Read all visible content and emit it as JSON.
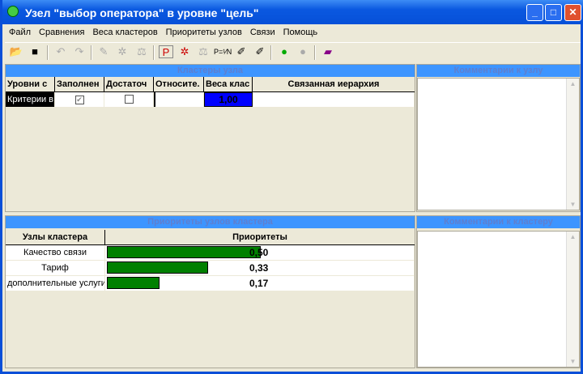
{
  "window": {
    "title": "Узел \"выбор оператора\" в уровне \"цель\"",
    "minimize": "_",
    "maximize": "□",
    "close": "✕"
  },
  "menu": [
    "Файл",
    "Сравнения",
    "Веса кластеров",
    "Приоритеты узлов",
    "Связи",
    "Помощь"
  ],
  "toolbar": {
    "icons": [
      "open-icon",
      "save-icon",
      "undo-icon",
      "redo-icon",
      "edit-icon",
      "wand-w-icon",
      "scales-w-icon",
      "priority-edit-icon",
      "wand-p-icon",
      "scales-p-icon",
      "p-equals-1-n-icon",
      "eraser-icon",
      "eraser-multi-icon",
      "connect-icon",
      "disconnect-icon",
      "help-book-icon"
    ]
  },
  "clusters": {
    "title": "Кластеры узла",
    "columns": [
      "Уровни с",
      "Заполнен",
      "Достаточ",
      "Относите.",
      "Веса клас",
      "Связанная иерархия"
    ],
    "rows": [
      {
        "level": "Критерии в",
        "filled": true,
        "sufficient": false,
        "relative": "",
        "weight": "1,00",
        "hierarchy": ""
      }
    ]
  },
  "node_comment": {
    "title": "Комментарии к узлу",
    "text": ""
  },
  "priorities": {
    "title": "Приоритеты узлов кластера",
    "columns": [
      "Узлы кластера",
      "Приоритеты"
    ],
    "rows": [
      {
        "name": "Качество связи",
        "value": 0.5,
        "label": "0,50"
      },
      {
        "name": "Тариф",
        "value": 0.33,
        "label": "0,33"
      },
      {
        "name": "дополнительные услуги",
        "value": 0.17,
        "label": "0,17"
      }
    ],
    "bar_color": "#008000"
  },
  "cluster_comment": {
    "title": "Комментарии к кластеру",
    "text": ""
  }
}
